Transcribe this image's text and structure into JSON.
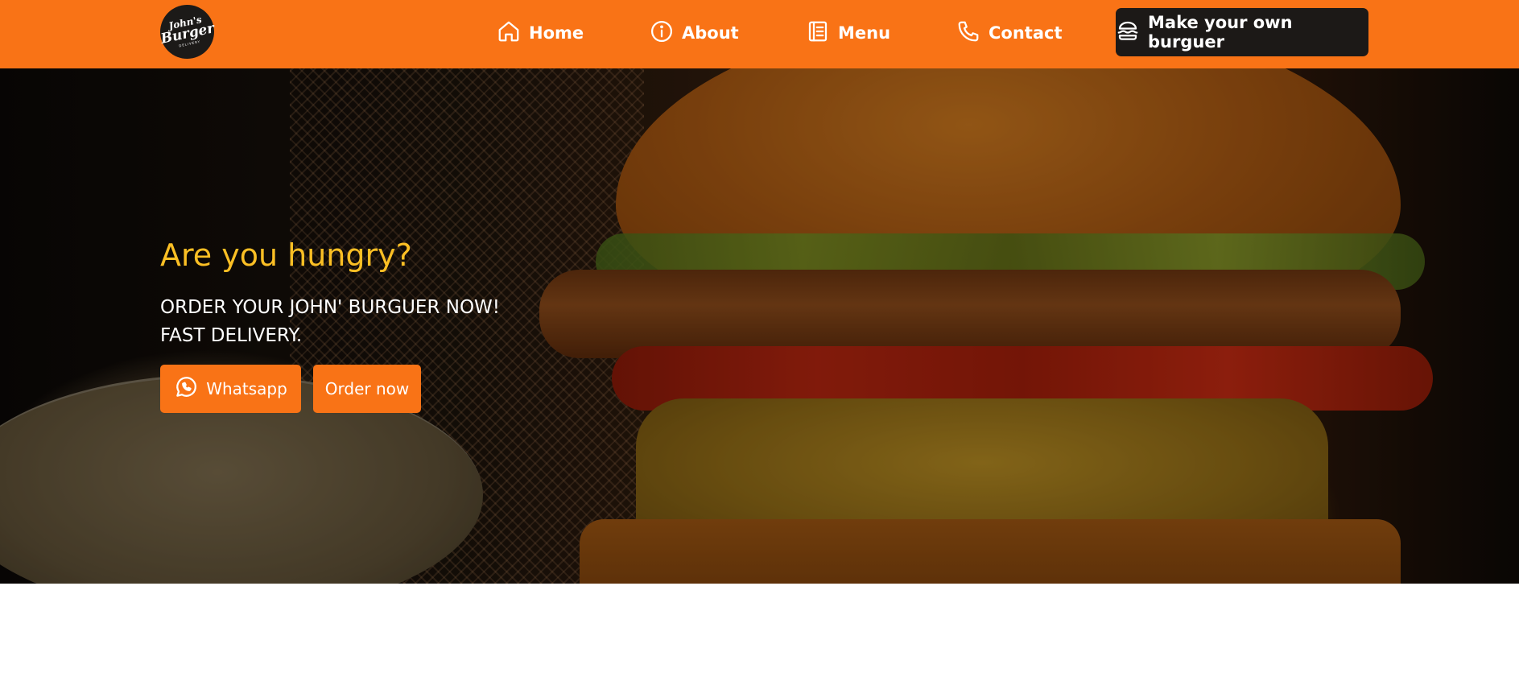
{
  "header": {
    "logo": {
      "line1": "John's",
      "line2": "Burger",
      "line3": "DELIVERY"
    },
    "nav": [
      {
        "label": "Home",
        "icon": "home-icon"
      },
      {
        "label": "About",
        "icon": "info-icon"
      },
      {
        "label": "Menu",
        "icon": "menu-icon"
      },
      {
        "label": "Contact",
        "icon": "phone-icon"
      }
    ],
    "cta": {
      "label": "Make your own burguer",
      "icon": "burger-icon"
    }
  },
  "hero": {
    "title": "Are you hungry?",
    "subtitle_line1": "ORDER YOUR JOHN' BURGUER NOW!",
    "subtitle_line2": "FAST DELIVERY.",
    "buttons": {
      "whatsapp": {
        "label": "Whatsapp",
        "icon": "whatsapp-icon"
      },
      "order": {
        "label": "Order now"
      }
    }
  },
  "colors": {
    "brand": "#f97316",
    "dark": "#1c1917",
    "accent": "#fbbf24",
    "text_light": "#ffffff"
  }
}
